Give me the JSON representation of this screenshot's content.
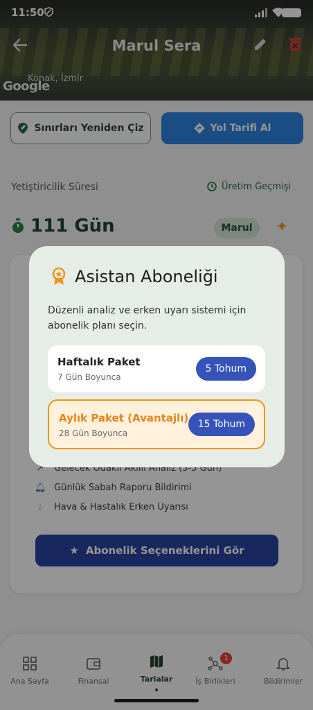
{
  "status_bar": {
    "time": "11:50"
  },
  "header": {
    "title": "Marul Sera",
    "location": "Konak, İzmir",
    "map_attribution": "Google"
  },
  "actions": {
    "redraw": "Sınırları Yeniden Çiz",
    "directions": "Yol Tarifi Al"
  },
  "growth": {
    "section_label": "Yetiştiricilik Süresi",
    "history_link": "Üretim Geçmişi",
    "days": "111 Gün",
    "crop": "Marul"
  },
  "card": {
    "features": [
      "Gelecek Odaklı Akıllı Analiz (3-5 Gün)",
      "Günlük Sabah Raporu Bildirimi",
      "Hava & Hastalık Erken Uyarısı"
    ],
    "cta": "Abonelik Seçeneklerini Gör"
  },
  "dialog": {
    "title": "Asistan Aboneliği",
    "description": "Düzenli analiz ve erken uyarı sistemi için abonelik planı seçin.",
    "options": [
      {
        "name": "Haftalık Paket",
        "duration": "7 Gün Boyunca",
        "price": "5 Tohum"
      },
      {
        "name": "Aylık Paket (Avantajlı)",
        "duration": "28 Gün Boyunca",
        "price": "15 Tohum"
      }
    ]
  },
  "nav": {
    "items": [
      "Ana Sayfa",
      "Finansal",
      "Tarlalar",
      "İş Birlikleri",
      "Bildirimler"
    ],
    "active": "Tarlalar",
    "badge": "1"
  },
  "colors": {
    "primary_blue": "#1f7ce0",
    "cta_navy": "#1d3a9c",
    "accent_orange": "#f0941a",
    "green_dark": "#153a25"
  }
}
